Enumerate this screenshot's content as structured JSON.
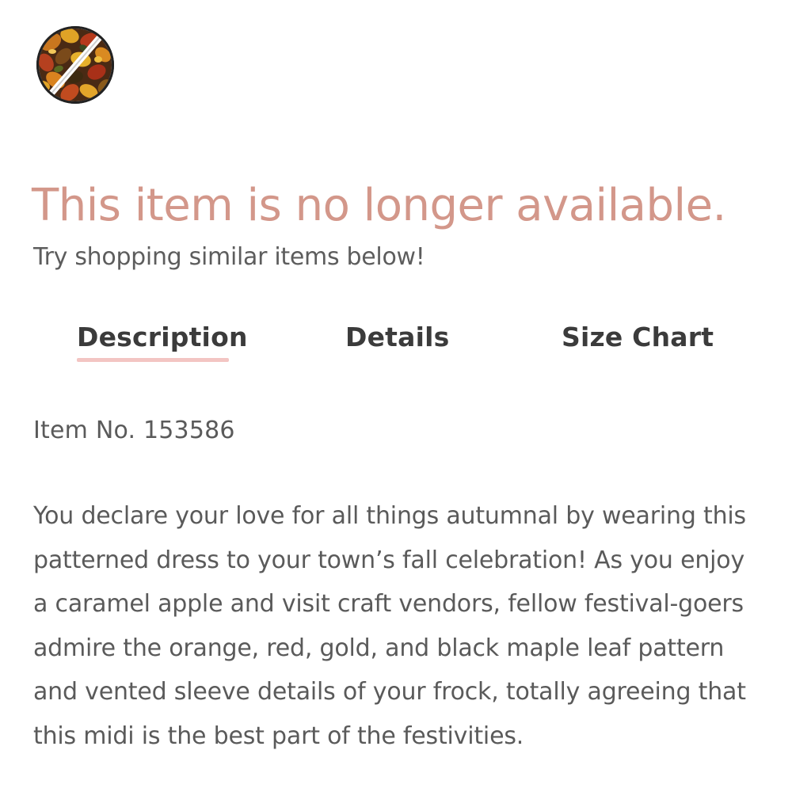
{
  "swatch": {
    "icon": "autumn-leaf-pattern-swatch-crossed-out",
    "state": "unavailable"
  },
  "notice": {
    "title": "This item is no longer available.",
    "subtitle": "Try shopping similar items below!"
  },
  "tabs": [
    {
      "label": "Description",
      "active": true
    },
    {
      "label": "Details",
      "active": false
    },
    {
      "label": "Size Chart",
      "active": false
    }
  ],
  "description": {
    "item_number": "Item No. 153586",
    "text": "You declare your love for all things autumnal by wearing this patterned dress to your town’s fall celebration! As you enjoy a caramel apple and visit craft vendors, fellow festival-goers admire the orange, red, gold, and black maple leaf pattern and vented sleeve details of your frock, totally agreeing that this midi is the best part of the festivities."
  },
  "colors": {
    "title": "#d3978a",
    "body_text": "#5a5a5a",
    "tab_text": "#3b3b3b",
    "tab_underline": "#f3c5c3"
  }
}
